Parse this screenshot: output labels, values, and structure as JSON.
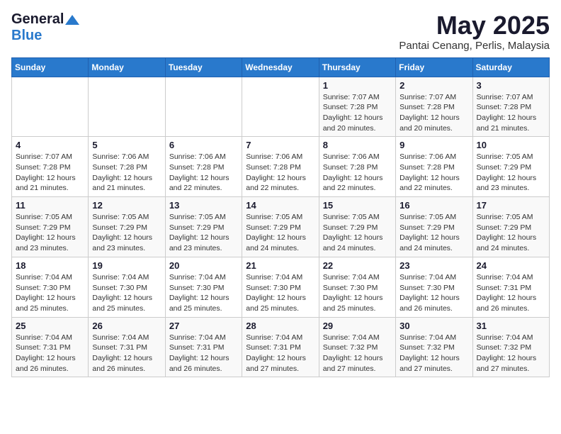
{
  "header": {
    "logo_general": "General",
    "logo_blue": "Blue",
    "month_year": "May 2025",
    "location": "Pantai Cenang, Perlis, Malaysia"
  },
  "days_of_week": [
    "Sunday",
    "Monday",
    "Tuesday",
    "Wednesday",
    "Thursday",
    "Friday",
    "Saturday"
  ],
  "weeks": [
    [
      {
        "num": "",
        "info": ""
      },
      {
        "num": "",
        "info": ""
      },
      {
        "num": "",
        "info": ""
      },
      {
        "num": "",
        "info": ""
      },
      {
        "num": "1",
        "info": "Sunrise: 7:07 AM\nSunset: 7:28 PM\nDaylight: 12 hours and 20 minutes."
      },
      {
        "num": "2",
        "info": "Sunrise: 7:07 AM\nSunset: 7:28 PM\nDaylight: 12 hours and 20 minutes."
      },
      {
        "num": "3",
        "info": "Sunrise: 7:07 AM\nSunset: 7:28 PM\nDaylight: 12 hours and 21 minutes."
      }
    ],
    [
      {
        "num": "4",
        "info": "Sunrise: 7:07 AM\nSunset: 7:28 PM\nDaylight: 12 hours and 21 minutes."
      },
      {
        "num": "5",
        "info": "Sunrise: 7:06 AM\nSunset: 7:28 PM\nDaylight: 12 hours and 21 minutes."
      },
      {
        "num": "6",
        "info": "Sunrise: 7:06 AM\nSunset: 7:28 PM\nDaylight: 12 hours and 22 minutes."
      },
      {
        "num": "7",
        "info": "Sunrise: 7:06 AM\nSunset: 7:28 PM\nDaylight: 12 hours and 22 minutes."
      },
      {
        "num": "8",
        "info": "Sunrise: 7:06 AM\nSunset: 7:28 PM\nDaylight: 12 hours and 22 minutes."
      },
      {
        "num": "9",
        "info": "Sunrise: 7:06 AM\nSunset: 7:28 PM\nDaylight: 12 hours and 22 minutes."
      },
      {
        "num": "10",
        "info": "Sunrise: 7:05 AM\nSunset: 7:29 PM\nDaylight: 12 hours and 23 minutes."
      }
    ],
    [
      {
        "num": "11",
        "info": "Sunrise: 7:05 AM\nSunset: 7:29 PM\nDaylight: 12 hours and 23 minutes."
      },
      {
        "num": "12",
        "info": "Sunrise: 7:05 AM\nSunset: 7:29 PM\nDaylight: 12 hours and 23 minutes."
      },
      {
        "num": "13",
        "info": "Sunrise: 7:05 AM\nSunset: 7:29 PM\nDaylight: 12 hours and 23 minutes."
      },
      {
        "num": "14",
        "info": "Sunrise: 7:05 AM\nSunset: 7:29 PM\nDaylight: 12 hours and 24 minutes."
      },
      {
        "num": "15",
        "info": "Sunrise: 7:05 AM\nSunset: 7:29 PM\nDaylight: 12 hours and 24 minutes."
      },
      {
        "num": "16",
        "info": "Sunrise: 7:05 AM\nSunset: 7:29 PM\nDaylight: 12 hours and 24 minutes."
      },
      {
        "num": "17",
        "info": "Sunrise: 7:05 AM\nSunset: 7:29 PM\nDaylight: 12 hours and 24 minutes."
      }
    ],
    [
      {
        "num": "18",
        "info": "Sunrise: 7:04 AM\nSunset: 7:30 PM\nDaylight: 12 hours and 25 minutes."
      },
      {
        "num": "19",
        "info": "Sunrise: 7:04 AM\nSunset: 7:30 PM\nDaylight: 12 hours and 25 minutes."
      },
      {
        "num": "20",
        "info": "Sunrise: 7:04 AM\nSunset: 7:30 PM\nDaylight: 12 hours and 25 minutes."
      },
      {
        "num": "21",
        "info": "Sunrise: 7:04 AM\nSunset: 7:30 PM\nDaylight: 12 hours and 25 minutes."
      },
      {
        "num": "22",
        "info": "Sunrise: 7:04 AM\nSunset: 7:30 PM\nDaylight: 12 hours and 25 minutes."
      },
      {
        "num": "23",
        "info": "Sunrise: 7:04 AM\nSunset: 7:30 PM\nDaylight: 12 hours and 26 minutes."
      },
      {
        "num": "24",
        "info": "Sunrise: 7:04 AM\nSunset: 7:31 PM\nDaylight: 12 hours and 26 minutes."
      }
    ],
    [
      {
        "num": "25",
        "info": "Sunrise: 7:04 AM\nSunset: 7:31 PM\nDaylight: 12 hours and 26 minutes."
      },
      {
        "num": "26",
        "info": "Sunrise: 7:04 AM\nSunset: 7:31 PM\nDaylight: 12 hours and 26 minutes."
      },
      {
        "num": "27",
        "info": "Sunrise: 7:04 AM\nSunset: 7:31 PM\nDaylight: 12 hours and 26 minutes."
      },
      {
        "num": "28",
        "info": "Sunrise: 7:04 AM\nSunset: 7:31 PM\nDaylight: 12 hours and 27 minutes."
      },
      {
        "num": "29",
        "info": "Sunrise: 7:04 AM\nSunset: 7:32 PM\nDaylight: 12 hours and 27 minutes."
      },
      {
        "num": "30",
        "info": "Sunrise: 7:04 AM\nSunset: 7:32 PM\nDaylight: 12 hours and 27 minutes."
      },
      {
        "num": "31",
        "info": "Sunrise: 7:04 AM\nSunset: 7:32 PM\nDaylight: 12 hours and 27 minutes."
      }
    ]
  ]
}
